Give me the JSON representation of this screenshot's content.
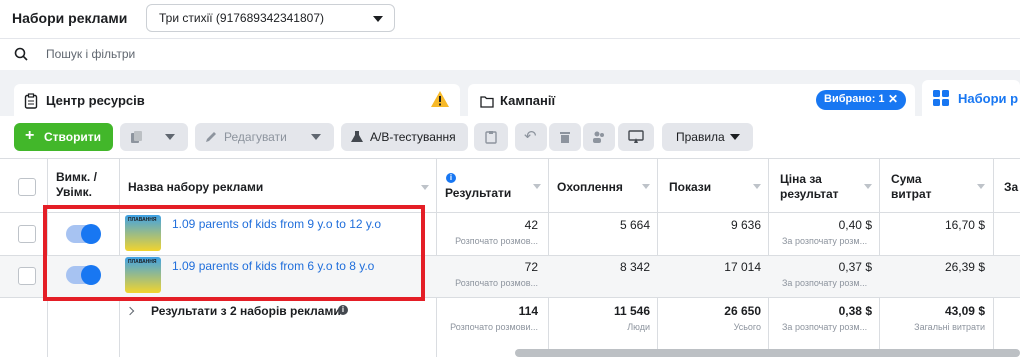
{
  "header": {
    "title": "Набори реклами",
    "account": "Три стихії (917689342341807)"
  },
  "search": {
    "placeholder": "Пошук і фільтри"
  },
  "tabs": {
    "resources": "Центр ресурсів",
    "campaigns": "Кампанії",
    "selected_badge": "Вибрано: 1",
    "adsets": "Набори р"
  },
  "toolbar": {
    "create": "Створити",
    "edit": "Редагувати",
    "ab": "A/B-тестування",
    "rules": "Правила"
  },
  "table": {
    "headers": {
      "toggle": "Вимк. / Увімк.",
      "name": "Назва набору реклами",
      "results": "Результати",
      "reach": "Охоплення",
      "impressions": "Покази",
      "cpr": "Ціна за результат",
      "spent": "Сума витрат",
      "last": "За"
    },
    "rows": [
      {
        "name": "1.09 parents of kids from 9 y.o to 12 y.o",
        "results": "42",
        "results_sub": "Розпочато розмов...",
        "reach": "5 664",
        "impressions": "9 636",
        "cpr": "0,40 $",
        "cpr_sub": "За розпочату розм...",
        "spent": "16,70 $"
      },
      {
        "name": "1.09 parents of kids from 6 y.o to 8 y.o",
        "results": "72",
        "results_sub": "Розпочато розмов...",
        "reach": "8 342",
        "impressions": "17 014",
        "cpr": "0,37 $",
        "cpr_sub": "За розпочату розм...",
        "spent": "26,39 $"
      }
    ],
    "summary": {
      "label": "Результати з 2 наборів реклами",
      "results": "114",
      "results_sub": "Розпочато розмови...",
      "reach": "11 546",
      "reach_sub": "Люди",
      "impressions": "26 650",
      "impressions_sub": "Усього",
      "cpr": "0,38 $",
      "cpr_sub": "За розпочату розм...",
      "spent": "43,09 $",
      "spent_sub": "Загальні витрати"
    }
  },
  "thumb_text": "ПЛАВАННЯ"
}
